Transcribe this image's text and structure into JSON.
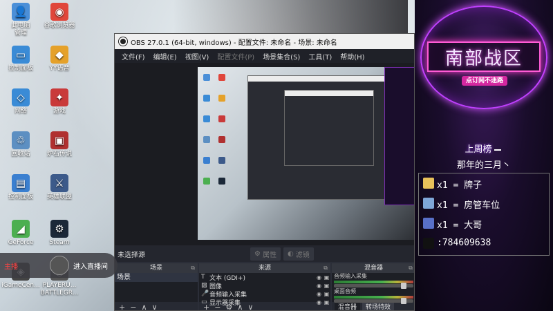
{
  "desktop": {
    "icons": [
      {
        "label": "此电脑\n管理",
        "glyph": "👤",
        "color": "#4a8fd8"
      },
      {
        "label": "谷歌浏览器",
        "glyph": "◉",
        "color": "#e0463b"
      },
      {
        "label": "控制面板",
        "glyph": "▭",
        "color": "#3a8bd6"
      },
      {
        "label": "YY语音",
        "glyph": "◆",
        "color": "#e5a12a"
      },
      {
        "label": "网络",
        "glyph": "◇",
        "color": "#3a8bd6"
      },
      {
        "label": "游戏",
        "glyph": "✦",
        "color": "#c93a3a"
      },
      {
        "label": "回收站",
        "glyph": "♲",
        "color": "#5c8fc2"
      },
      {
        "label": "炉石传说",
        "glyph": "▣",
        "color": "#b03030"
      },
      {
        "label": "控制面板",
        "glyph": "▤",
        "color": "#3a7fd0"
      },
      {
        "label": "英雄联盟",
        "glyph": "⚔",
        "color": "#3c5a8a"
      },
      {
        "label": "GeForce",
        "glyph": "◢",
        "color": "#4caf50"
      },
      {
        "label": "Steam",
        "glyph": "⚙",
        "color": "#1b2838"
      },
      {
        "label": "iGameCen...",
        "glyph": "◈",
        "color": "#444"
      },
      {
        "label": "PLAYERU...\nBATTLEGR...",
        "glyph": "◎",
        "color": "#555"
      }
    ]
  },
  "obs": {
    "title": "OBS 27.0.1 (64-bit, windows) - 配置文件: 未命名 - 场景: 未命名",
    "menu": [
      {
        "label": "文件(F)",
        "dim": false
      },
      {
        "label": "编辑(E)",
        "dim": false
      },
      {
        "label": "视图(V)",
        "dim": false
      },
      {
        "label": "配置文件(P)",
        "dim": true
      },
      {
        "label": "场景集合(S)",
        "dim": false
      },
      {
        "label": "工具(T)",
        "dim": false
      },
      {
        "label": "帮助(H)",
        "dim": false
      }
    ],
    "no_source_label": "未选择源",
    "properties_label": "属性",
    "filters_label": "滤镜",
    "scenes": {
      "header": "场景",
      "items": [
        "场景"
      ]
    },
    "sources": {
      "header": "来源",
      "items": [
        {
          "icon": "T",
          "label": "文本 (GDI+)"
        },
        {
          "icon": "▨",
          "label": "图像"
        },
        {
          "icon": "🎤",
          "label": "音频输入采集"
        },
        {
          "icon": "▭",
          "label": "显示器采集"
        }
      ]
    },
    "mixer": {
      "header": "混音器",
      "channel1": "音频输入采集",
      "channel2": "桌面音频",
      "tab1": "混音器",
      "tab2": "转场特效"
    }
  },
  "overlay": {
    "logo": "南部战区",
    "sub_banner": "点订阅不迷路",
    "last_week": "上周榜",
    "that_year": "那年的三月丶",
    "ranks": [
      {
        "text": "x1 = 牌子",
        "color": "#e8c25a"
      },
      {
        "text": "x1 = 房管车位",
        "color": "#7fa7d8"
      },
      {
        "text": "x1 = 大哥",
        "color": "#5870c8"
      },
      {
        "text": ":784609638",
        "color": "#111"
      }
    ]
  },
  "popup": {
    "name": "主播",
    "message": "进入直播间"
  }
}
